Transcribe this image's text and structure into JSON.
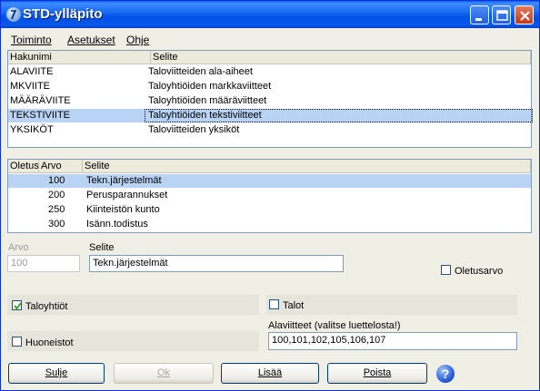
{
  "window": {
    "title": "STD-ylläpito"
  },
  "menu": [
    "Toiminto",
    "Asetukset",
    "Ohje"
  ],
  "top_list": {
    "headers": [
      "Hakunimi",
      "Selite"
    ],
    "rows": [
      {
        "hakunimi": "ALAVIITE",
        "selite": "Taloviitteiden ala-aiheet"
      },
      {
        "hakunimi": "MKVIITE",
        "selite": "Taloyhtiöiden markkaviitteet"
      },
      {
        "hakunimi": "MÄÄRÄVIITE",
        "selite": "Taloyhtiöiden määräviitteet"
      },
      {
        "hakunimi": "TEKSTIVIITE",
        "selite": "Taloyhtiöiden tekstiviitteet"
      },
      {
        "hakunimi": "YKSIKÖT",
        "selite": "Taloviitteiden yksiköt"
      }
    ],
    "selected_index": 3
  },
  "bottom_list": {
    "headers": [
      "Oletus",
      "Arvo",
      "Selite"
    ],
    "rows": [
      {
        "oletus": "",
        "arvo": "100",
        "selite": "Tekn.järjestelmät"
      },
      {
        "oletus": "",
        "arvo": "200",
        "selite": "Perusparannukset"
      },
      {
        "oletus": "",
        "arvo": "250",
        "selite": "Kiinteistön kunto"
      },
      {
        "oletus": "",
        "arvo": "300",
        "selite": "Isänn.todistus"
      }
    ],
    "selected_index": 0
  },
  "form": {
    "arvo_label": "Arvo",
    "arvo_value": "100",
    "selite_label": "Selite",
    "selite_value": "Tekn.järjestelmät",
    "oletusarvo_label": "Oletusarvo",
    "oletusarvo_checked": false,
    "taloyhtiot_label": "Taloyhtiöt",
    "taloyhtiot_checked": true,
    "talot_label": "Talot",
    "talot_checked": false,
    "huoneistot_label": "Huoneistot",
    "huoneistot_checked": false,
    "alaviitteet_label": "Alaviitteet (valitse luettelosta!)",
    "alaviitteet_value": "100,101,102,105,106,107"
  },
  "buttons": {
    "sulje": "Sulje",
    "ok": "Ok",
    "lisaa": "Lisää",
    "poista": "Poista",
    "help": "?"
  },
  "colors": {
    "titlebar": "#0054e3",
    "selection": "#b8d3f3",
    "window_bg": "#f0efe6"
  }
}
